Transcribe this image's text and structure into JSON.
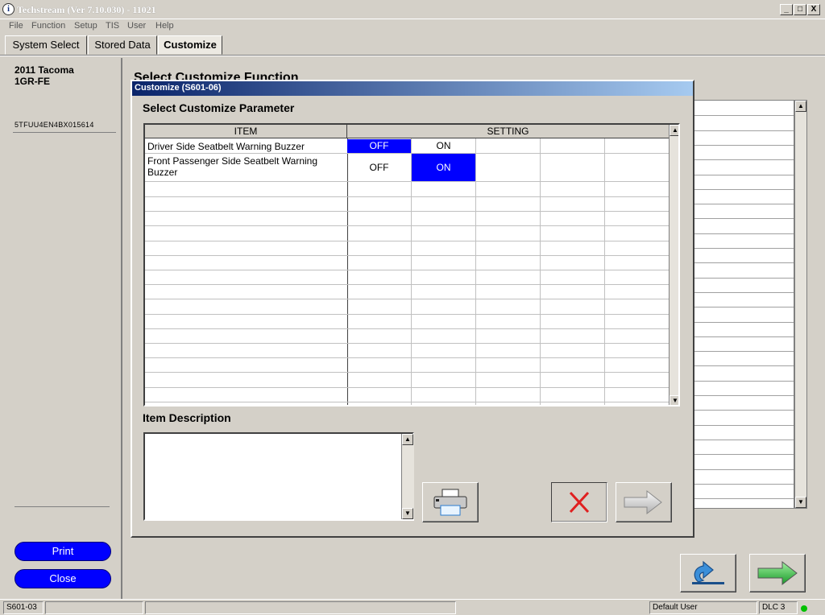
{
  "window": {
    "title": "Techstream (Ver 7.10.030) - 11021",
    "icon_letter": "i",
    "minimize": "_",
    "maximize": "□",
    "close": "X"
  },
  "menu": [
    "File",
    "Function",
    "Setup",
    "TIS",
    "User",
    "Help"
  ],
  "tabs": [
    {
      "label": "System Select"
    },
    {
      "label": "Stored Data"
    },
    {
      "label": "Customize",
      "active": true
    }
  ],
  "vehicle": {
    "model": "2011 Tacoma",
    "engine": "1GR-FE",
    "vin": "5TFUU4EN4BX015614"
  },
  "left_buttons": {
    "print": "Print",
    "close": "Close"
  },
  "background": {
    "heading": "Select Customize Function"
  },
  "dialog": {
    "title": "Customize (S601-06)",
    "heading": "Select Customize Parameter",
    "columns": {
      "item": "ITEM",
      "setting": "SETTING"
    },
    "rows": [
      {
        "item": "Driver Side Seatbelt Warning Buzzer",
        "settings": [
          "OFF",
          "ON"
        ],
        "selected": "OFF"
      },
      {
        "item_line1": "Front Passenger Side Seatbelt Warning",
        "item_line2": "Buzzer",
        "settings": [
          "OFF",
          "ON"
        ],
        "selected": "ON"
      }
    ],
    "description_label": "Item Description",
    "description_text": ""
  },
  "icons": {
    "print": "printer-icon",
    "cancel": "red-x-icon",
    "next": "right-arrow-icon",
    "back": "undo-arrow-icon",
    "forward": "green-arrow-icon"
  },
  "status": {
    "screen_id": "S601-03",
    "user": "Default User",
    "connector": "DLC 3",
    "connection_color": "#00c000"
  },
  "colors": {
    "selection": "#0000ff",
    "title_gradient_start": "#0a246a",
    "title_gradient_end": "#a6caf0"
  }
}
